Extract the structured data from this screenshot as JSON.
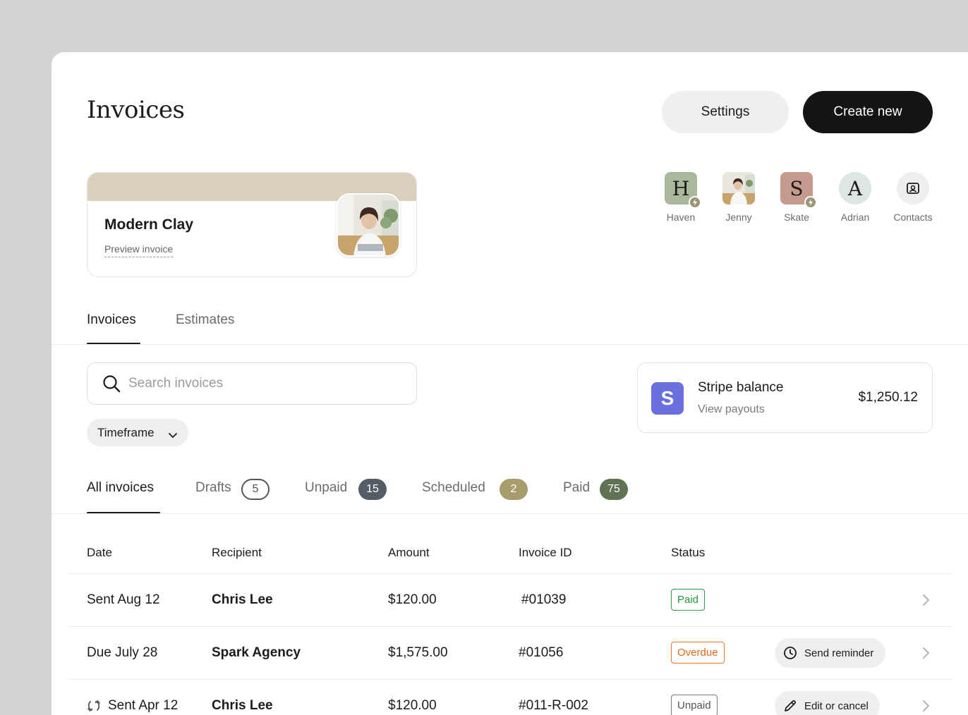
{
  "header": {
    "title": "Invoices",
    "settings_label": "Settings",
    "create_label": "Create new"
  },
  "business_card": {
    "name": "Modern Clay",
    "preview_label": "Preview invoice"
  },
  "contacts": [
    {
      "initial": "H",
      "name": "Haven",
      "color": "#a9b79a"
    },
    {
      "initial": "",
      "name": "Jenny",
      "color": "#cfd6d0"
    },
    {
      "initial": "S",
      "name": "Skate",
      "color": "#c49b8c"
    },
    {
      "initial": "A",
      "name": "Adrian",
      "color": "#dde6e0"
    },
    {
      "initial": "",
      "name": "Contacts",
      "color": "#eeefed"
    }
  ],
  "main_tabs": [
    {
      "label": "Invoices",
      "active": true
    },
    {
      "label": "Estimates",
      "active": false
    }
  ],
  "search": {
    "placeholder": "Search invoices"
  },
  "timeframe": {
    "label": "Timeframe"
  },
  "stripe": {
    "logo": "S",
    "title": "Stripe balance",
    "subtitle": "View payouts",
    "amount": "$1,250.12"
  },
  "filters": [
    {
      "label": "All invoices",
      "count": "",
      "active": true
    },
    {
      "label": "Drafts",
      "count": "5"
    },
    {
      "label": "Unpaid",
      "count": "15"
    },
    {
      "label": "Scheduled",
      "count": "2"
    },
    {
      "label": "Paid",
      "count": "75"
    }
  ],
  "table": {
    "columns": [
      "Date",
      "Recipient",
      "Amount",
      "Invoice ID",
      "Status"
    ],
    "rows": [
      {
        "date": "Sent Aug 12",
        "recipient": "Chris Lee",
        "amount": "$120.00",
        "invoice_id": "#01039",
        "status": "Paid",
        "action": ""
      },
      {
        "date": "Due July 28",
        "recipient": "Spark Agency",
        "amount": "$1,575.00",
        "invoice_id": "#01056",
        "status": "Overdue",
        "action": "Send reminder"
      },
      {
        "date": "Sent Apr 12",
        "recipient": "Chris Lee",
        "amount": "$120.00",
        "invoice_id": "#011-R-002",
        "status": "Unpaid",
        "action": "Edit or cancel"
      }
    ]
  },
  "colors": {
    "accent_dark": "#141414",
    "paid": "#1f9a3e",
    "overdue": "#e0651b",
    "stripe": "#6a6fe0"
  }
}
